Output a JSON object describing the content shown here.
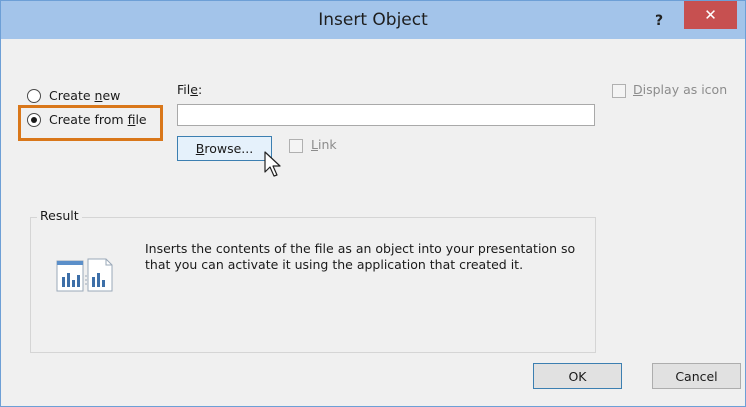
{
  "dialog": {
    "title": "Insert Object",
    "help_label": "?",
    "close_label": "✕"
  },
  "options": {
    "create_new_prefix": "Create ",
    "create_new_key": "n",
    "create_new_suffix": "ew",
    "create_from_file_prefix": "Create from ",
    "create_from_file_key": "f",
    "create_from_file_suffix": "ile",
    "selected": "create_from_file"
  },
  "file": {
    "label_prefix": "Fil",
    "label_key": "e",
    "label_suffix": ":",
    "value": "",
    "browse_key": "B",
    "browse_suffix": "rowse...",
    "link_key": "L",
    "link_suffix": "ink"
  },
  "display_as_icon": {
    "key": "D",
    "suffix": "isplay as icon",
    "checked": false
  },
  "result": {
    "legend": "Result",
    "text": "Inserts the contents of the file as an object into your presentation so that you can activate it using the application that created it."
  },
  "buttons": {
    "ok": "OK",
    "cancel": "Cancel"
  },
  "colors": {
    "title_bar": "#a3c4ea",
    "close_button": "#c75050",
    "highlight": "#d9771a"
  }
}
